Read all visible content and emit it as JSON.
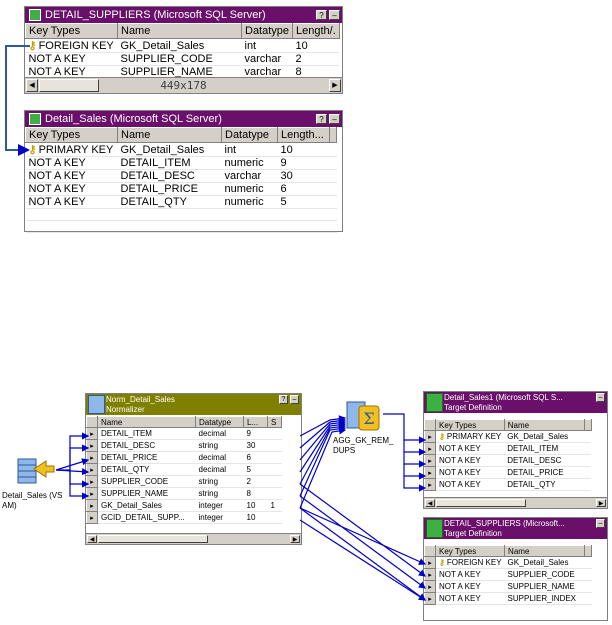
{
  "top_windows": {
    "suppliers": {
      "title": "DETAIL_SUPPLIERS (Microsoft SQL Server)",
      "columns": [
        "Key Types",
        "Name",
        "Datatype",
        "Length/."
      ],
      "rows": [
        [
          "FOREIGN KEY",
          "GK_Detail_Sales",
          "int",
          "10"
        ],
        [
          "NOT A KEY",
          "SUPPLIER_CODE",
          "varchar",
          "2"
        ],
        [
          "NOT A KEY",
          "SUPPLIER_NAME",
          "varchar",
          "8"
        ]
      ],
      "size_label": "449x178"
    },
    "sales": {
      "title": "Detail_Sales (Microsoft SQL Server)",
      "columns": [
        "Key Types",
        "Name",
        "Datatype",
        "Length..."
      ],
      "rows": [
        [
          "PRIMARY KEY",
          "GK_Detail_Sales",
          "int",
          "10"
        ],
        [
          "NOT A KEY",
          "DETAIL_ITEM",
          "numeric",
          "9"
        ],
        [
          "NOT A KEY",
          "DETAIL_DESC",
          "varchar",
          "30"
        ],
        [
          "NOT A KEY",
          "DETAIL_PRICE",
          "numeric",
          "6"
        ],
        [
          "NOT A KEY",
          "DETAIL_QTY",
          "numeric",
          "5"
        ]
      ]
    }
  },
  "mapping": {
    "source": {
      "label_line1": "Detail_Sales (VS",
      "label_line2": "AM)"
    },
    "normalizer": {
      "title": "Norm_Detail_Sales",
      "subtitle": "Normalizer",
      "columns": [
        "Name",
        "Datatype",
        "L...",
        "S"
      ],
      "rows": [
        [
          "DETAIL_ITEM",
          "decimal",
          "9",
          ""
        ],
        [
          "DETAIL_DESC",
          "string",
          "30",
          ""
        ],
        [
          "DETAIL_PRICE",
          "decimal",
          "6",
          ""
        ],
        [
          "DETAIL_QTY",
          "decimal",
          "5",
          ""
        ],
        [
          "SUPPLIER_CODE",
          "string",
          "2",
          ""
        ],
        [
          "SUPPLIER_NAME",
          "string",
          "8",
          ""
        ],
        [
          "GK_Detail_Sales",
          "integer",
          "10",
          "1"
        ],
        [
          "GCID_DETAIL_SUPP...",
          "integer",
          "10",
          ""
        ]
      ]
    },
    "aggregator": {
      "label_line1": "AGG_GK_REM_",
      "label_line2": "DUPS"
    },
    "target_sales": {
      "title": "Detail_Sales1 (Microsoft SQL S...",
      "subtitle": "Target Definition",
      "columns": [
        "Key Types",
        "Name"
      ],
      "rows": [
        [
          "PRIMARY KEY",
          "GK_Detail_Sales"
        ],
        [
          "NOT A KEY",
          "DETAIL_ITEM"
        ],
        [
          "NOT A KEY",
          "DETAIL_DESC"
        ],
        [
          "NOT A KEY",
          "DETAIL_PRICE"
        ],
        [
          "NOT A KEY",
          "DETAIL_QTY"
        ]
      ]
    },
    "target_suppliers": {
      "title": "DETAIL_SUPPLIERS (Microsoft...",
      "subtitle": "Target Definition",
      "columns": [
        "Key Types",
        "Name"
      ],
      "rows": [
        [
          "FOREIGN KEY",
          "GK_Detail_Sales"
        ],
        [
          "NOT A KEY",
          "SUPPLIER_CODE"
        ],
        [
          "NOT A KEY",
          "SUPPLIER_NAME"
        ],
        [
          "NOT A KEY",
          "SUPPLIER_INDEX"
        ]
      ]
    }
  },
  "colors": {
    "title_purple": "#6a0f6a",
    "title_olive": "#7f7f00",
    "link_blue": "#0000c8",
    "key_gold": "#c8a000"
  },
  "icons": {
    "key": "key-icon",
    "minimize": "minimize-icon",
    "help": "help-icon"
  }
}
